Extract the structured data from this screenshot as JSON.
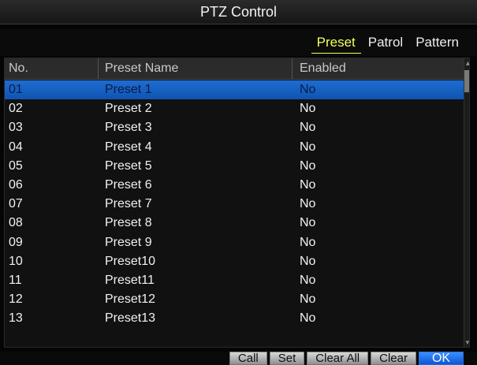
{
  "window": {
    "title": "PTZ Control"
  },
  "tabs": [
    {
      "label": "Preset",
      "active": true
    },
    {
      "label": "Patrol",
      "active": false
    },
    {
      "label": "Pattern",
      "active": false
    }
  ],
  "table": {
    "columns": [
      "No.",
      "Preset Name",
      "Enabled"
    ],
    "rows": [
      [
        "01",
        "Preset 1",
        "No"
      ],
      [
        "02",
        "Preset 2",
        "No"
      ],
      [
        "03",
        "Preset 3",
        "No"
      ],
      [
        "04",
        "Preset 4",
        "No"
      ],
      [
        "05",
        "Preset 5",
        "No"
      ],
      [
        "06",
        "Preset 6",
        "No"
      ],
      [
        "07",
        "Preset 7",
        "No"
      ],
      [
        "08",
        "Preset 8",
        "No"
      ],
      [
        "09",
        "Preset 9",
        "No"
      ],
      [
        "10",
        "Preset10",
        "No"
      ],
      [
        "11",
        "Preset11",
        "No"
      ],
      [
        "12",
        "Preset12",
        "No"
      ],
      [
        "13",
        "Preset13",
        "No"
      ]
    ],
    "selected_row_index": 0
  },
  "buttons": [
    {
      "label": "Call"
    },
    {
      "label": "Set"
    },
    {
      "label": "Clear All"
    },
    {
      "label": "Clear"
    },
    {
      "label": "OK"
    }
  ],
  "colors": {
    "active_tab": "#f4ff5c",
    "selection": "#1e6cd2",
    "ok_button": "#2b79ef"
  }
}
